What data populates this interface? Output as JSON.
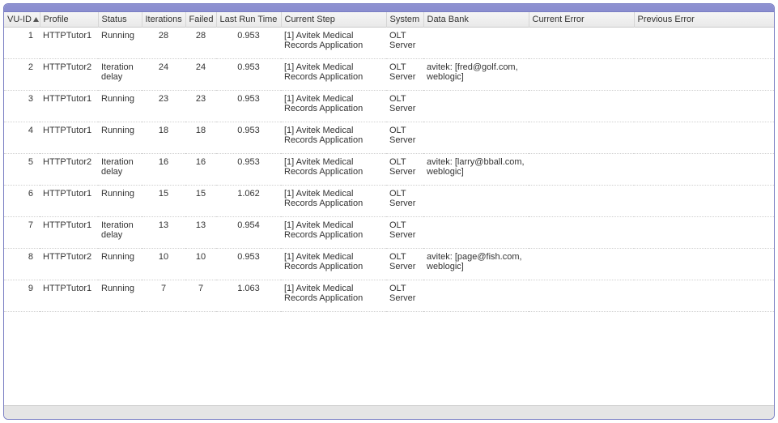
{
  "grid": {
    "columns": [
      {
        "key": "vuid",
        "label": "VU-ID",
        "sortable": true,
        "class": "c-vuid",
        "align": "right"
      },
      {
        "key": "profile",
        "label": "Profile",
        "sortable": false,
        "class": "c-prof",
        "align": "left"
      },
      {
        "key": "status",
        "label": "Status",
        "sortable": false,
        "class": "c-stat",
        "align": "left"
      },
      {
        "key": "iterations",
        "label": "Iterations",
        "sortable": false,
        "class": "c-iter",
        "align": "center"
      },
      {
        "key": "failed",
        "label": "Failed",
        "sortable": false,
        "class": "c-fail",
        "align": "center"
      },
      {
        "key": "last_run_time",
        "label": "Last Run Time",
        "sortable": false,
        "class": "c-lrt",
        "align": "center"
      },
      {
        "key": "current_step",
        "label": "Current Step",
        "sortable": false,
        "class": "c-step",
        "align": "left"
      },
      {
        "key": "system",
        "label": "System",
        "sortable": false,
        "class": "c-sys",
        "align": "left"
      },
      {
        "key": "data_bank",
        "label": "Data Bank",
        "sortable": false,
        "class": "c-db",
        "align": "left"
      },
      {
        "key": "current_error",
        "label": "Current Error",
        "sortable": false,
        "class": "c-ce",
        "align": "left"
      },
      {
        "key": "previous_error",
        "label": "Previous Error",
        "sortable": false,
        "class": "c-pe",
        "align": "left"
      }
    ],
    "rows": [
      {
        "vuid": "1",
        "profile": "HTTPTutor1",
        "status": "Running",
        "iterations": "28",
        "failed": "28",
        "last_run_time": "0.953",
        "current_step": "[1] Avitek Medical Records Application",
        "system": "OLT Server",
        "data_bank": "",
        "current_error": "",
        "previous_error": ""
      },
      {
        "vuid": "2",
        "profile": "HTTPTutor2",
        "status": "Iteration delay",
        "iterations": "24",
        "failed": "24",
        "last_run_time": "0.953",
        "current_step": "[1] Avitek Medical Records Application",
        "system": "OLT Server",
        "data_bank": "avitek: [fred@golf.com, weblogic]",
        "current_error": "",
        "previous_error": ""
      },
      {
        "vuid": "3",
        "profile": "HTTPTutor1",
        "status": "Running",
        "iterations": "23",
        "failed": "23",
        "last_run_time": "0.953",
        "current_step": "[1] Avitek Medical Records Application",
        "system": "OLT Server",
        "data_bank": "",
        "current_error": "",
        "previous_error": ""
      },
      {
        "vuid": "4",
        "profile": "HTTPTutor1",
        "status": "Running",
        "iterations": "18",
        "failed": "18",
        "last_run_time": "0.953",
        "current_step": "[1] Avitek Medical Records Application",
        "system": "OLT Server",
        "data_bank": "",
        "current_error": "",
        "previous_error": ""
      },
      {
        "vuid": "5",
        "profile": "HTTPTutor2",
        "status": "Iteration delay",
        "iterations": "16",
        "failed": "16",
        "last_run_time": "0.953",
        "current_step": "[1] Avitek Medical Records Application",
        "system": "OLT Server",
        "data_bank": "avitek: [larry@bball.com, weblogic]",
        "current_error": "",
        "previous_error": ""
      },
      {
        "vuid": "6",
        "profile": "HTTPTutor1",
        "status": "Running",
        "iterations": "15",
        "failed": "15",
        "last_run_time": "1.062",
        "current_step": "[1] Avitek Medical Records Application",
        "system": "OLT Server",
        "data_bank": "",
        "current_error": "",
        "previous_error": ""
      },
      {
        "vuid": "7",
        "profile": "HTTPTutor1",
        "status": "Iteration delay",
        "iterations": "13",
        "failed": "13",
        "last_run_time": "0.954",
        "current_step": "[1] Avitek Medical Records Application",
        "system": "OLT Server",
        "data_bank": "",
        "current_error": "",
        "previous_error": ""
      },
      {
        "vuid": "8",
        "profile": "HTTPTutor2",
        "status": "Running",
        "iterations": "10",
        "failed": "10",
        "last_run_time": "0.953",
        "current_step": "[1] Avitek Medical Records Application",
        "system": "OLT Server",
        "data_bank": "avitek: [page@fish.com, weblogic]",
        "current_error": "",
        "previous_error": ""
      },
      {
        "vuid": "9",
        "profile": "HTTPTutor1",
        "status": "Running",
        "iterations": "7",
        "failed": "7",
        "last_run_time": "1.063",
        "current_step": "[1] Avitek Medical Records Application",
        "system": "OLT Server",
        "data_bank": "",
        "current_error": "",
        "previous_error": ""
      }
    ]
  }
}
